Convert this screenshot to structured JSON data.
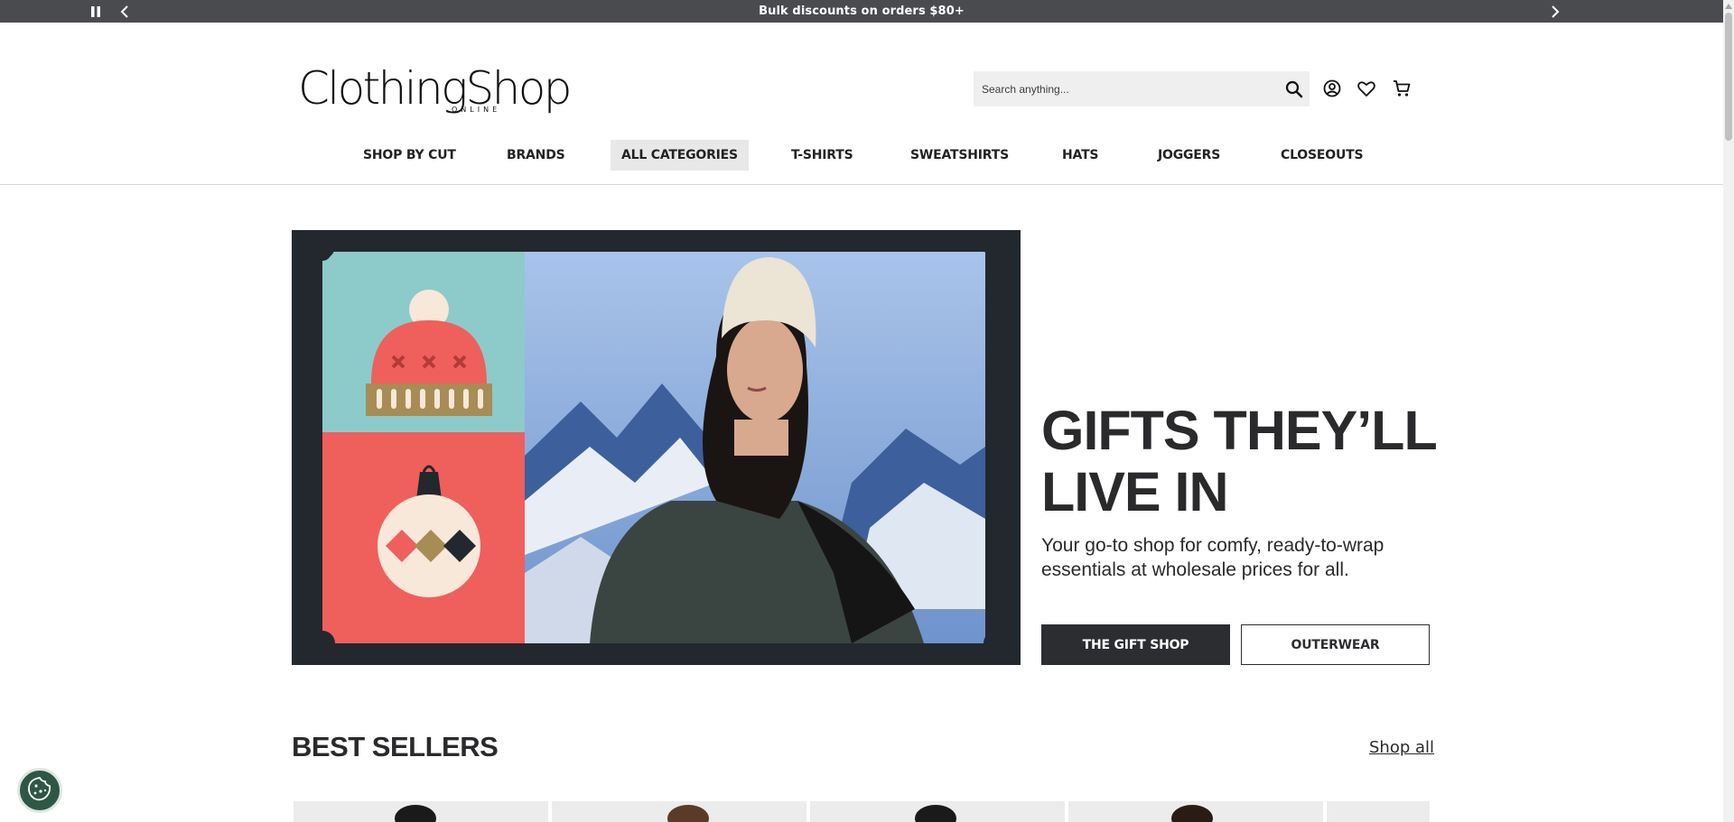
{
  "announcement": {
    "message": "Bulk discounts on orders $80+",
    "pause_icon": "pause-icon",
    "prev_icon": "chevron-left-icon",
    "next_icon": "chevron-right-icon"
  },
  "header": {
    "logo_text": "ClothingShop",
    "logo_subtext": "ONLINE",
    "search_placeholder": "Search anything...",
    "search_value": "",
    "icons": [
      "search-icon",
      "account-icon",
      "heart-icon",
      "cart-icon"
    ]
  },
  "nav": {
    "items": [
      {
        "label": "SHOP BY CUT",
        "active": false
      },
      {
        "label": "BRANDS",
        "active": false
      },
      {
        "label": "ALL CATEGORIES",
        "active": true
      },
      {
        "label": "T-SHIRTS",
        "active": false
      },
      {
        "label": "SWEATSHIRTS",
        "active": false
      },
      {
        "label": "HATS",
        "active": false
      },
      {
        "label": "JOGGERS",
        "active": false
      },
      {
        "label": "CLOSEOUTS",
        "active": false
      }
    ]
  },
  "hero": {
    "title_line1": "GIFTS THEY’LL",
    "title_line2": "LIVE IN",
    "subtitle": "Your go-to shop for comfy, ready-to-wrap essentials at wholesale prices for all.",
    "primary_button": "THE GIFT SHOP",
    "secondary_button": "OUTERWEAR"
  },
  "best_sellers": {
    "title": "BEST SELLERS",
    "shop_all": "Shop all"
  },
  "cookie": {
    "icon": "cookie-icon"
  },
  "colors": {
    "announce_bg": "#4a4b4f",
    "hero_bg": "#23272e",
    "primary_button_bg": "#2c2d30",
    "cookie_bg": "#2f5745",
    "teal_tile": "#8ccbca",
    "coral_tile": "#ef5f5c"
  }
}
